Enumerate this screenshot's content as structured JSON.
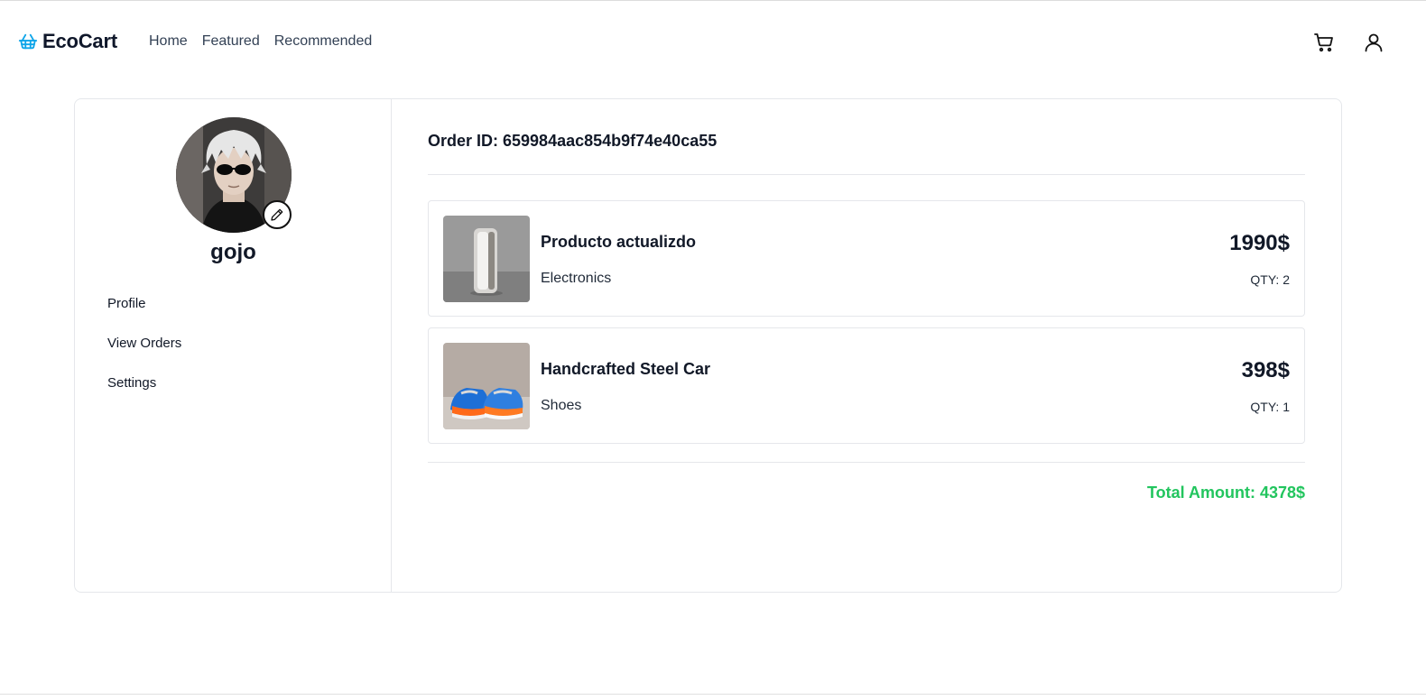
{
  "navbar": {
    "brand": "EcoCart",
    "links": [
      "Home",
      "Featured",
      "Recommended"
    ]
  },
  "profile": {
    "username": "gojo",
    "menu": [
      "Profile",
      "View Orders",
      "Settings"
    ]
  },
  "order": {
    "id_label": "Order ID: 659984aac854b9f74e40ca55",
    "items": [
      {
        "name": "Producto actualizdo",
        "category": "Electronics",
        "price": "1990$",
        "qty": "QTY: 2"
      },
      {
        "name": "Handcrafted Steel Car",
        "category": "Shoes",
        "price": "398$",
        "qty": "QTY: 1"
      }
    ],
    "total_label": "Total Amount: 4378$"
  },
  "colors": {
    "brand_icon": "#0ea5e9",
    "total": "#22c55e"
  },
  "icons": [
    "basket-icon",
    "cart-icon",
    "user-icon",
    "pencil-icon"
  ]
}
